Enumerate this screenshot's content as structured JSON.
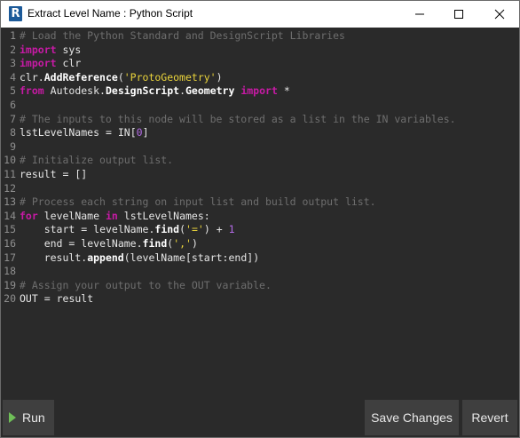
{
  "window": {
    "title": "Extract Level Name : Python Script",
    "icon_letter": "R",
    "controls": [
      "minimize-icon",
      "maximize-icon",
      "close-icon"
    ]
  },
  "editor": {
    "line_numbers": [
      "1",
      "2",
      "3",
      "4",
      "5",
      "6",
      "7",
      "8",
      "9",
      "10",
      "11",
      "12",
      "13",
      "14",
      "15",
      "16",
      "17",
      "18",
      "19",
      "20"
    ],
    "lines": [
      "# Load the Python Standard and DesignScript Libraries",
      "import sys",
      "import clr",
      "clr.AddReference('ProtoGeometry')",
      "from Autodesk.DesignScript.Geometry import *",
      "",
      "# The inputs to this node will be stored as a list in the IN variables.",
      "lstLevelNames = IN[0]",
      "",
      "# Initialize output list.",
      "result = []",
      "",
      "# Process each string on input list and build output list.",
      "for levelName in lstLevelNames:",
      "    start = levelName.find('=') + 1",
      "    end = levelName.find(',')",
      "    result.append(levelName[start:end])",
      "",
      "# Assign your output to the OUT variable.",
      "OUT = result"
    ]
  },
  "toolbar": {
    "run_label": "Run",
    "save_label": "Save Changes",
    "revert_label": "Revert"
  },
  "colors": {
    "background": "#2a2a2a",
    "keyword": "#c71aa5",
    "comment": "#6e6e6e",
    "string": "#e9d33b",
    "number": "#b36be6",
    "run_icon": "#6fbf58"
  }
}
